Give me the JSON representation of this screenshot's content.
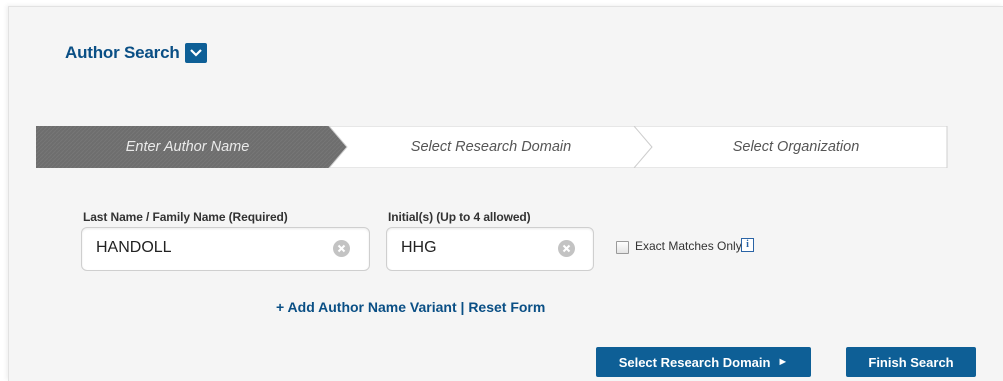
{
  "header": {
    "title": "Author Search",
    "toggle_icon": "chevron-down-icon"
  },
  "stepper": {
    "steps": [
      {
        "label": "Enter Author Name",
        "active": true
      },
      {
        "label": "Select Research Domain",
        "active": false
      },
      {
        "label": "Select Organization",
        "active": false
      }
    ],
    "active_color": "#6e6e6e"
  },
  "form": {
    "last_name": {
      "label": "Last Name / Family Name  (Required)",
      "value": "HANDOLL"
    },
    "initials": {
      "label": "Initial(s)  (Up to 4 allowed)",
      "value": "HHG"
    },
    "exact_match": {
      "label": "Exact Matches Only",
      "checked": false,
      "info_icon": "info-icon"
    }
  },
  "links": {
    "add_variant": "+ Add Author Name Variant",
    "separator": "|",
    "reset": "Reset Form"
  },
  "buttons": {
    "select_domain": "Select Research Domain",
    "select_domain_arrow": "►",
    "finish": "Finish Search"
  },
  "colors": {
    "brand": "#0e5f96",
    "title": "#0a4f85"
  }
}
